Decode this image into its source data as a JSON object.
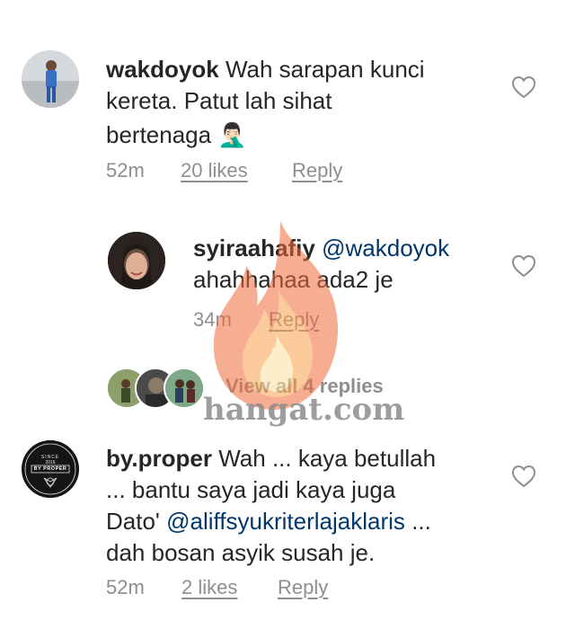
{
  "comments": [
    {
      "username": "wakdoyok",
      "text_line1": "Wah sarapan kunci",
      "text_line2": "kereta. Patut lah sihat",
      "text_line3": "bertenaga",
      "emoji": "🤦🏻‍♂️",
      "time": "52m",
      "likes": "20 likes",
      "reply": "Reply"
    },
    {
      "username": "syiraahafiy",
      "mention": "@wakdoyok",
      "text_line2": "ahahhahaa ada2 je",
      "time": "34m",
      "reply": "Reply"
    },
    {
      "username": "by.proper",
      "text_line1": "Wah ... kaya betullah",
      "text_line2": "... bantu saya jadi kaya juga",
      "text_line3_prefix": "Dato'",
      "mention": "@aliffsyukriterlajaklaris",
      "text_line3_suffix": "...",
      "text_line4": "dah bosan asyik susah je.",
      "time": "52m",
      "likes": "2 likes",
      "reply": "Reply",
      "avatar_badge": {
        "top": "BY PROPER",
        "since": "SINCE",
        "year": "2016",
        "label": "BY PROPER"
      }
    }
  ],
  "replies_toggle": "View all 4 replies",
  "watermark": "hangat.com",
  "colors": {
    "text": "#262626",
    "muted": "#8e8e8e",
    "mention": "#00376b",
    "watermark_flame": "#f26b3a",
    "watermark_text": "#8c8c8c"
  }
}
